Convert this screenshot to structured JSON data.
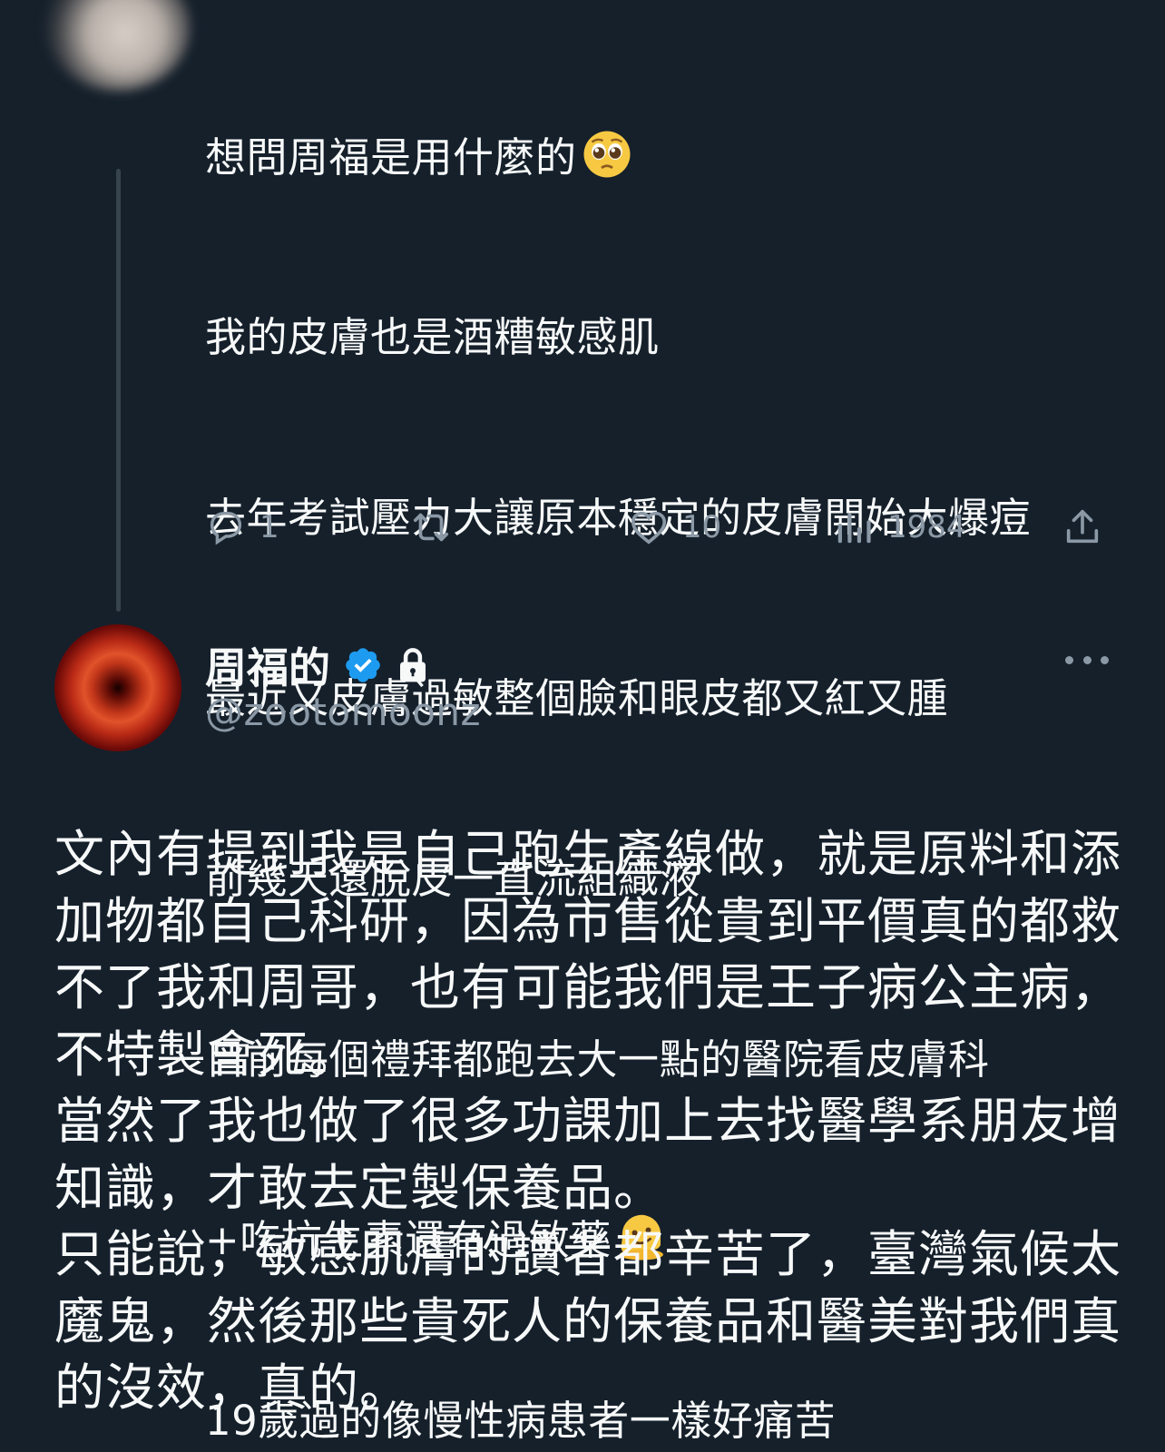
{
  "parent_tweet": {
    "lines": [
      "想問周福是用什麼的",
      "我的皮膚也是酒糟敏感肌",
      "去年考試壓力大讓原本穩定的皮膚開始大爆痘",
      "最近又皮膚過敏整個臉和眼皮都又紅又腫",
      "前幾天還脫皮一直流組織液",
      "目前每個禮拜都跑去大一點的醫院看皮膚科",
      "+吃抗生素還有過敏藥",
      "19歲過的像慢性病患者一樣好痛苦"
    ],
    "emoji_line1": "pleading-face",
    "emoji_line7": "melting-face",
    "actions": {
      "reply_count": "1",
      "retweet_count": "",
      "like_count": "10",
      "view_count": "1984"
    }
  },
  "main_tweet": {
    "author_name": "周福的",
    "handle": "@zootomoonz",
    "verified": true,
    "protected": true,
    "lines": [
      "文內有提到我是自己跑生產線做，就是原料和添",
      "加物都自己科研，因為市售從貴到平價真的都救",
      "不了我和周哥，也有可能我們是王子病公主病，",
      "不特製會死。",
      "當然了我也做了很多功課加上去找醫學系朋友增",
      "知識，才敢去定製保養品。",
      "只能說，敏感肌膚的讀者都辛苦了，臺灣氣候太",
      "魔鬼，然後那些貴死人的保養品和醫美對我們真",
      "的沒效，真的。"
    ]
  },
  "colors": {
    "background": "#15202b",
    "text": "#f7f9f9",
    "secondary": "#8b98a5",
    "thread_line": "#38444d",
    "verified_blue": "#1d9bf0"
  }
}
